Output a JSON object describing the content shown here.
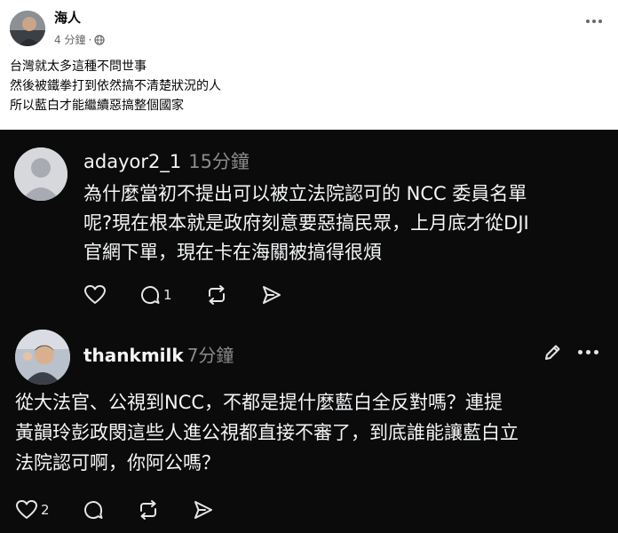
{
  "post": {
    "author": "海人",
    "time": "4 分鐘",
    "lines": [
      "台灣就太多這種不問世事",
      "然後被鐵拳打到依然搞不清楚狀況的人",
      "所以藍白才能繼續惡搞整個國家"
    ]
  },
  "threads": {
    "comment1": {
      "username": "adayor2_1",
      "time": "15分鐘",
      "lines": [
        "為什麼當初不提出可以被立法院認可的 NCC 委員名單",
        "呢?現在根本就是政府刻意要惡搞民眾，上月底才從DJI",
        "官網下單，現在卡在海關被搞得很煩"
      ],
      "reply_count": "1"
    },
    "comment2": {
      "username": "thankmilk",
      "time": "7分鐘",
      "lines": [
        "從大法官、公視到NCC，不都是提什麼藍白全反對嗎？連提",
        "黃韻玲彭政閔這些人進公視都直接不審了，到底誰能讓藍白立",
        "法院認可啊，你阿公嗎？"
      ],
      "like_count": "2"
    }
  },
  "colors": {
    "threads_bg": "#0b0b0b",
    "threads_text": "#f3f5f7",
    "threads_muted": "#8a8a8a",
    "fb_text": "#050505",
    "fb_muted": "#65676b"
  }
}
